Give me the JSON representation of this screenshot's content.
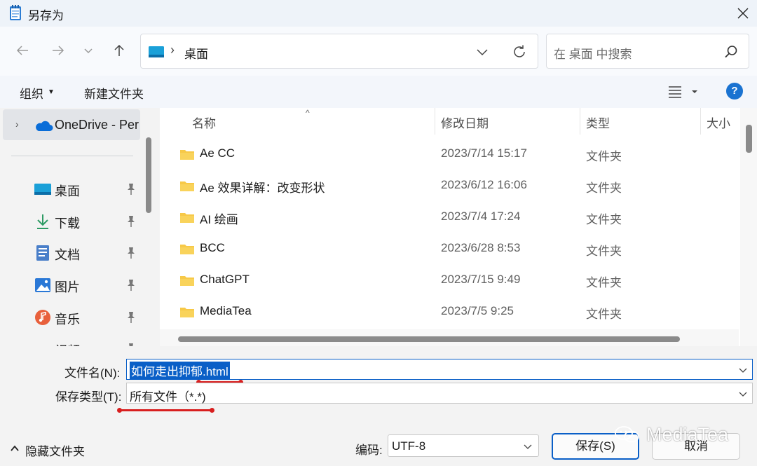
{
  "window": {
    "title": "另存为"
  },
  "address": {
    "path": "桌面",
    "separator": "›"
  },
  "search": {
    "placeholder": "在 桌面 中搜索"
  },
  "commands": {
    "organize": "组织",
    "new_folder": "新建文件夹"
  },
  "sidebar": {
    "expand_glyph": "›",
    "onedrive": "OneDrive - Per",
    "items": [
      {
        "label": "桌面",
        "icon": "desktop-icon"
      },
      {
        "label": "下载",
        "icon": "download-icon"
      },
      {
        "label": "文档",
        "icon": "document-icon"
      },
      {
        "label": "图片",
        "icon": "picture-icon"
      },
      {
        "label": "音乐",
        "icon": "music-icon"
      },
      {
        "label": "视频",
        "icon": "video-icon"
      }
    ]
  },
  "columns": {
    "name": "名称",
    "modified": "修改日期",
    "type": "类型",
    "size": "大小"
  },
  "files": [
    {
      "name": "Ae CC",
      "modified": "2023/7/14 15:17",
      "type": "文件夹"
    },
    {
      "name": "Ae 效果详解：改变形状",
      "modified": "2023/6/12 16:06",
      "type": "文件夹"
    },
    {
      "name": "AI 绘画",
      "modified": "2023/7/4 17:24",
      "type": "文件夹"
    },
    {
      "name": "BCC",
      "modified": "2023/6/28 8:53",
      "type": "文件夹"
    },
    {
      "name": "ChatGPT",
      "modified": "2023/7/15 9:49",
      "type": "文件夹"
    },
    {
      "name": "MediaTea",
      "modified": "2023/7/5 9:25",
      "type": "文件夹"
    }
  ],
  "form": {
    "filename_label": "文件名(N):",
    "filename_value": "如何走出抑郁.html",
    "savetype_label": "保存类型(T):",
    "savetype_value": "所有文件（*.*)",
    "encoding_label": "编码:",
    "encoding_value": "UTF-8"
  },
  "footer": {
    "hide_folders": "隐藏文件夹",
    "save": "保存(S)",
    "cancel": "取消"
  },
  "watermark": {
    "text": "MediaTea"
  },
  "colors": {
    "accent": "#0a5fc7",
    "folder": "#f7c948",
    "annotation": "#d81e1e",
    "help": "#1a73d1"
  }
}
